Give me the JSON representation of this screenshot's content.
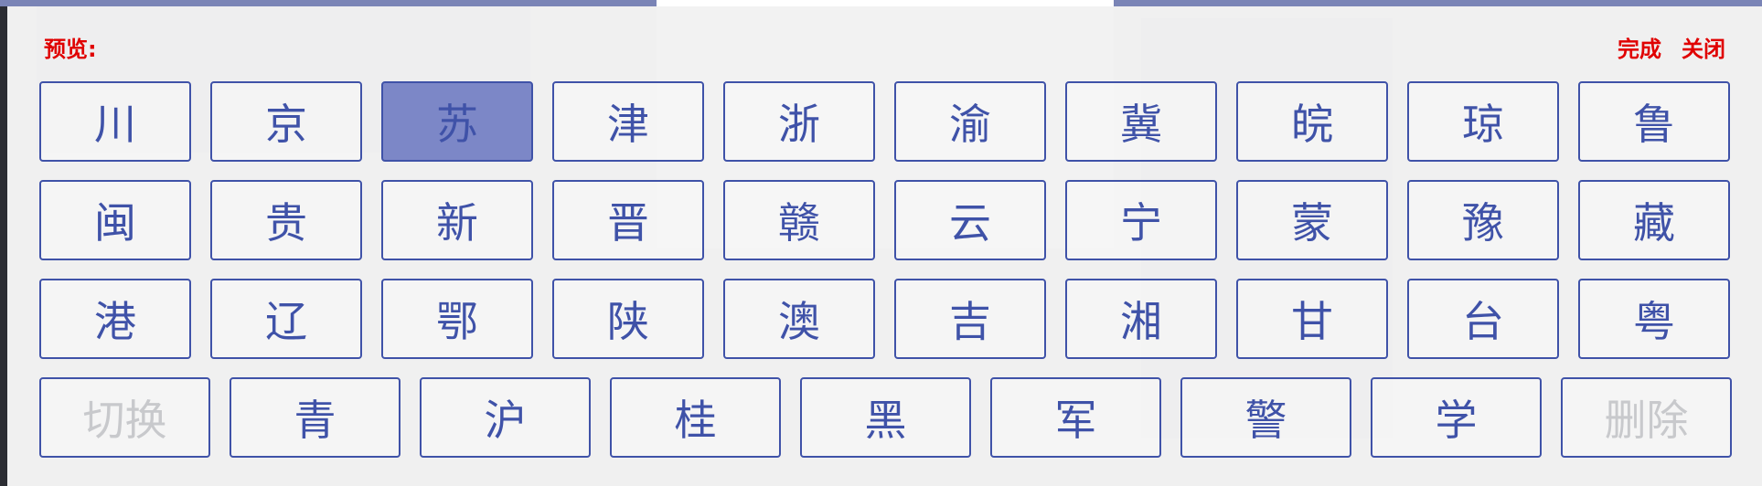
{
  "header": {
    "preview_label": "预览:",
    "done_label": "完成",
    "close_label": "关闭"
  },
  "keyboard": {
    "row1": [
      "川",
      "京",
      "苏",
      "津",
      "浙",
      "渝",
      "冀",
      "皖",
      "琼",
      "鲁"
    ],
    "row2": [
      "闽",
      "贵",
      "新",
      "晋",
      "赣",
      "云",
      "宁",
      "蒙",
      "豫",
      "藏"
    ],
    "row3": [
      "港",
      "辽",
      "鄂",
      "陕",
      "澳",
      "吉",
      "湘",
      "甘",
      "台",
      "粤"
    ],
    "row4": [
      "切换",
      "青",
      "沪",
      "桂",
      "黑",
      "军",
      "警",
      "学",
      "删除"
    ],
    "selected_key": "苏",
    "disabled_keys": [
      "切换",
      "删除"
    ]
  },
  "colors": {
    "accent": "#3f52a8",
    "selected_bg": "#7c87c7",
    "header_text": "#e00000",
    "disabled_text": "#c8c9cc"
  }
}
